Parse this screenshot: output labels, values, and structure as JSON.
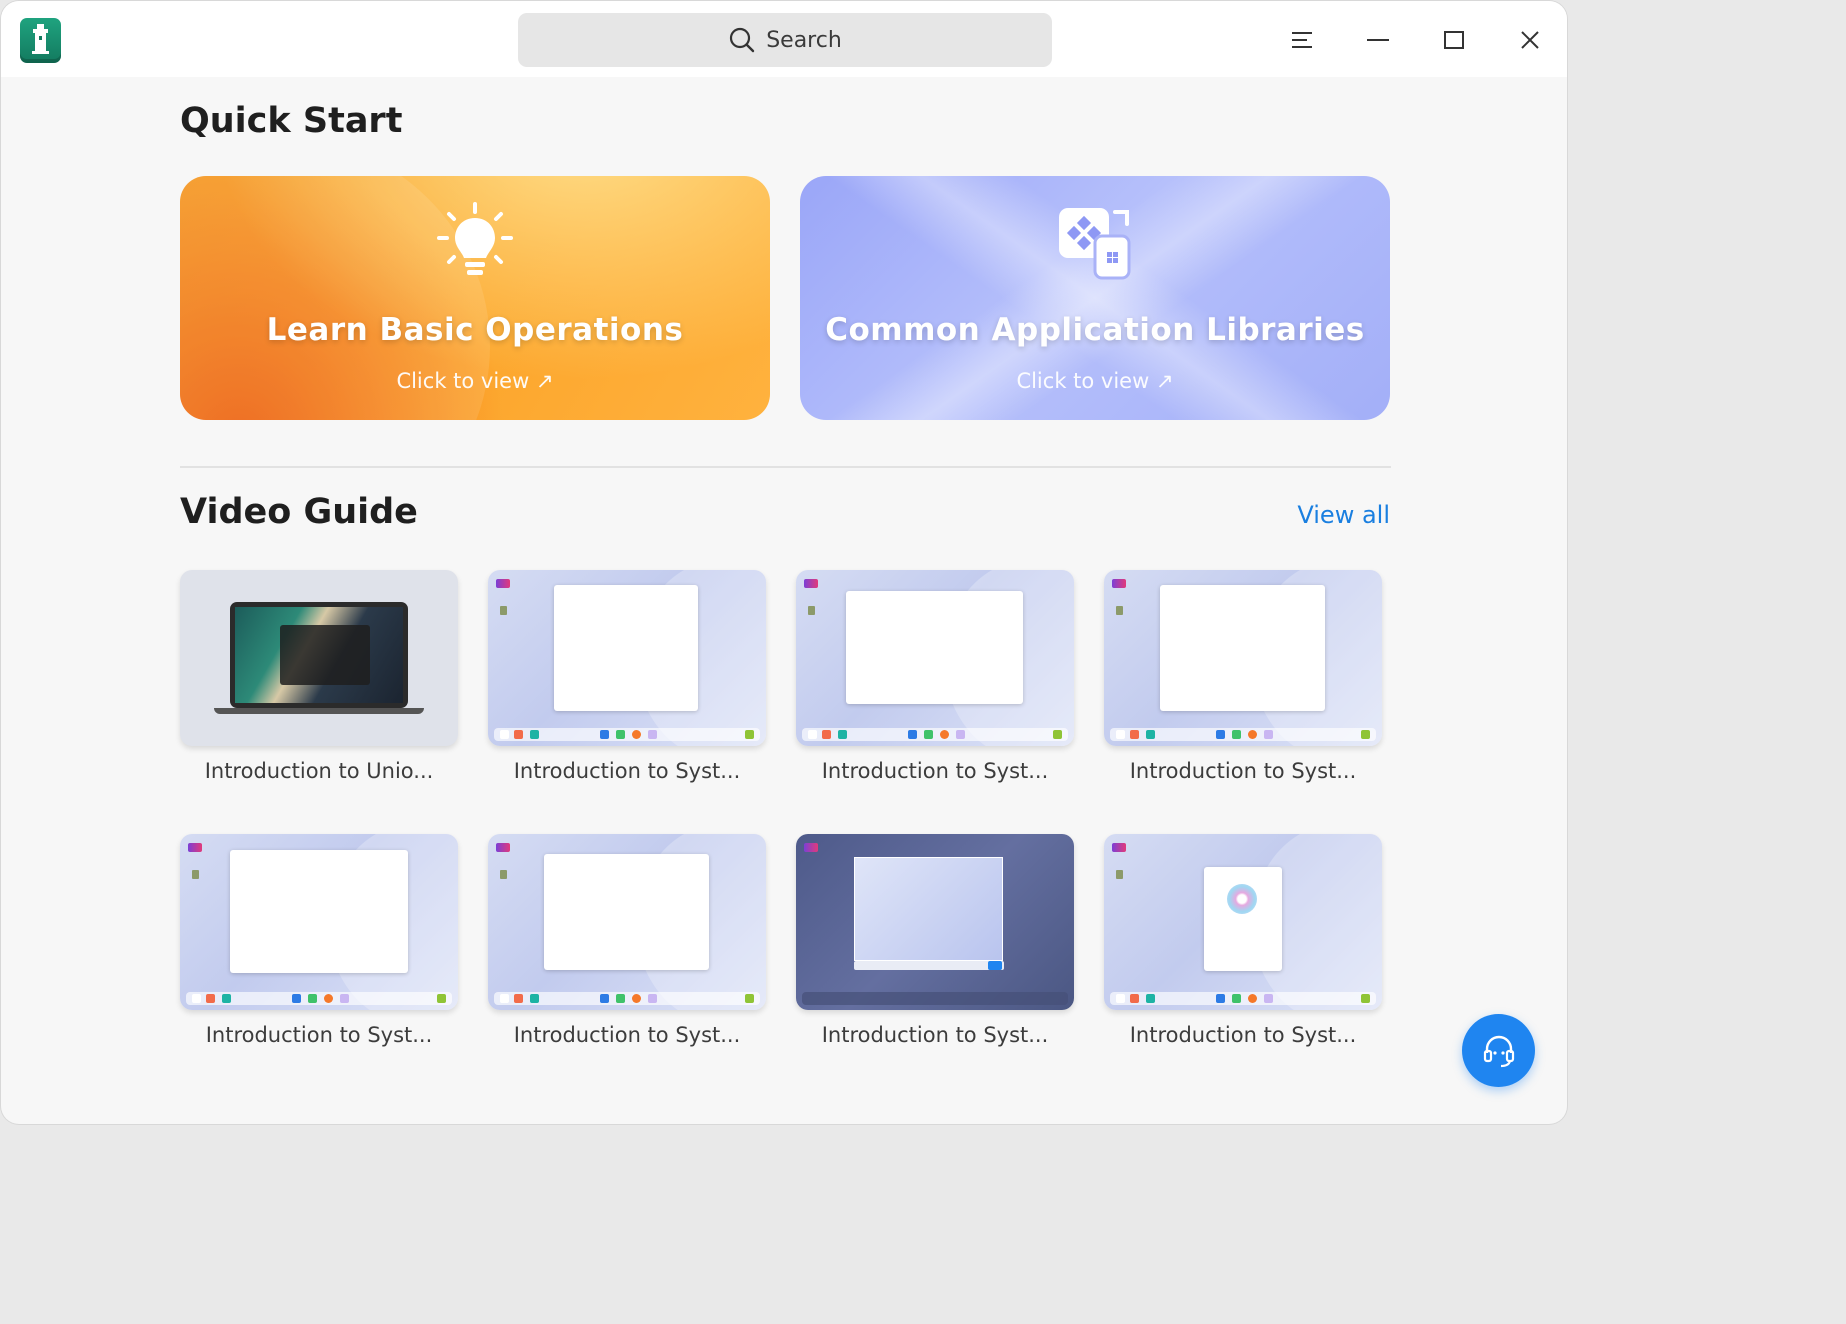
{
  "window": {
    "search": {
      "label": "Search"
    }
  },
  "quick_start": {
    "title": "Quick Start",
    "cards": [
      {
        "title": "Learn Basic Operations",
        "link": "Click to view ↗"
      },
      {
        "title": "Common Application Libraries",
        "link": "Click to view ↗"
      }
    ]
  },
  "video_guide": {
    "title": "Video Guide",
    "view_all": "View all",
    "videos": [
      {
        "label": "Introduction to Unio..."
      },
      {
        "label": "Introduction to Syst..."
      },
      {
        "label": "Introduction to Syst..."
      },
      {
        "label": "Introduction to Syst..."
      },
      {
        "label": "Introduction to Syst..."
      },
      {
        "label": "Introduction to Syst..."
      },
      {
        "label": "Introduction to Syst..."
      },
      {
        "label": "Introduction to Syst..."
      }
    ]
  },
  "colors": {
    "accent": "#1f85f0",
    "link": "#1a7fe0",
    "orange_card": "#f59a1f",
    "blue_card": "#a3aff8"
  },
  "icons": {
    "app": "lighthouse-icon",
    "search": "search-icon",
    "menu": "menu-icon",
    "minimize": "minimize-icon",
    "maximize": "maximize-icon",
    "close": "close-icon",
    "support": "headset-icon"
  }
}
